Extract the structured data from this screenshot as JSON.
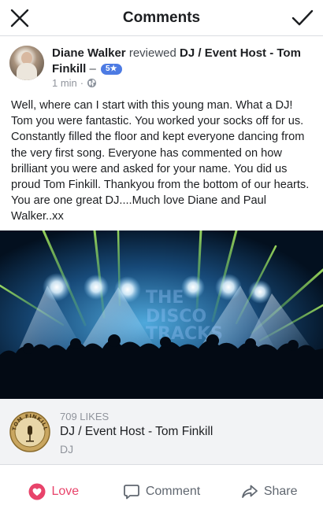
{
  "header": {
    "title": "Comments",
    "close_icon": "close-icon",
    "confirm_icon": "checkmark-icon"
  },
  "post": {
    "author": "Diane Walker",
    "verb": "reviewed",
    "page_name": "DJ / Event Host - Tom Finkill",
    "separator": "–",
    "rating": "5★",
    "time": "1 min",
    "audience_icon": "globe-icon",
    "text": "Well, where can I start with this young man.  What a DJ! Tom you were fantastic. You worked your socks off for us. Constantly filled the floor and kept everyone dancing from the very first song. Everyone has commented on how brilliant you were and asked for your name.  You did us proud Tom Finkill. Thankyou from the bottom of our hearts. You are one great DJ....Much love Diane and Paul Walker..xx"
  },
  "page_card": {
    "likes": "709 LIKES",
    "name": "DJ / Event Host - Tom Finkill",
    "category": "DJ",
    "logo_text": "TOM FINKILL"
  },
  "actions": {
    "love": "Love",
    "comment": "Comment",
    "share": "Share"
  },
  "colors": {
    "love": "#e8436a",
    "rating_badge": "#4d7be3",
    "muted": "#90949c",
    "card_bg": "#f2f3f5"
  }
}
